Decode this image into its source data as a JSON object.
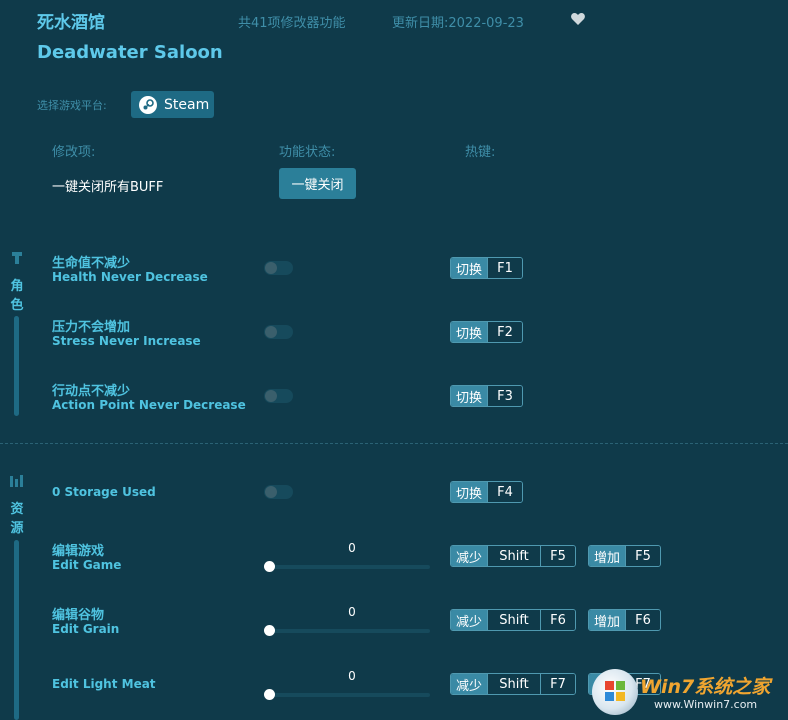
{
  "header": {
    "title_cn": "死水酒馆",
    "feature_count": "共41项修改器功能",
    "update_date": "更新日期:2022-09-23",
    "title_en": "Deadwater Saloon"
  },
  "platform": {
    "label": "选择游戏平台:",
    "button": "Steam"
  },
  "columns": {
    "mod": "修改项:",
    "status": "功能状态:",
    "hotkey": "热键:"
  },
  "buff": {
    "label": "一键关闭所有BUFF",
    "button": "一键关闭"
  },
  "sections": [
    {
      "name_chars": [
        "角",
        "色"
      ]
    },
    {
      "name_chars": [
        "资",
        "源"
      ]
    }
  ],
  "rows": [
    {
      "name_cn": "生命值不减少",
      "name_en": "Health Never Decrease",
      "action": "切换",
      "key": "F1",
      "enabled": false
    },
    {
      "name_cn": "压力不会增加",
      "name_en": "Stress Never Increase",
      "action": "切换",
      "key": "F2",
      "enabled": false
    },
    {
      "name_cn": "行动点不减少",
      "name_en": "Action Point Never Decrease",
      "action": "切换",
      "key": "F3",
      "enabled": false
    },
    {
      "name_cn": "",
      "name_en": "0 Storage Used",
      "action": "切换",
      "key": "F4",
      "enabled": false
    }
  ],
  "sliders": [
    {
      "name_cn": "编辑游戏",
      "name_en": "Edit Game",
      "value": "0",
      "dec_action": "减少",
      "dec_mod": "Shift",
      "dec_key": "F5",
      "inc_action": "增加",
      "inc_key": "F5"
    },
    {
      "name_cn": "编辑谷物",
      "name_en": "Edit Grain",
      "value": "0",
      "dec_action": "减少",
      "dec_mod": "Shift",
      "dec_key": "F6",
      "inc_action": "增加",
      "inc_key": "F6"
    },
    {
      "name_cn": "",
      "name_en": "Edit Light Meat",
      "value": "0",
      "dec_action": "减少",
      "dec_mod": "Shift",
      "dec_key": "F7",
      "inc_action": "增加",
      "inc_key": "F7"
    }
  ],
  "watermark": {
    "brand": "Win7系统之家",
    "url": "www.Winwin7.com"
  },
  "icons": {
    "favorite": "heart-icon",
    "steam": "steam-icon",
    "character": "character-icon",
    "resources": "resources-icon"
  },
  "colors": {
    "background": "#0f3a4a",
    "accent": "#4fc3e0",
    "button": "#2b7f99"
  }
}
